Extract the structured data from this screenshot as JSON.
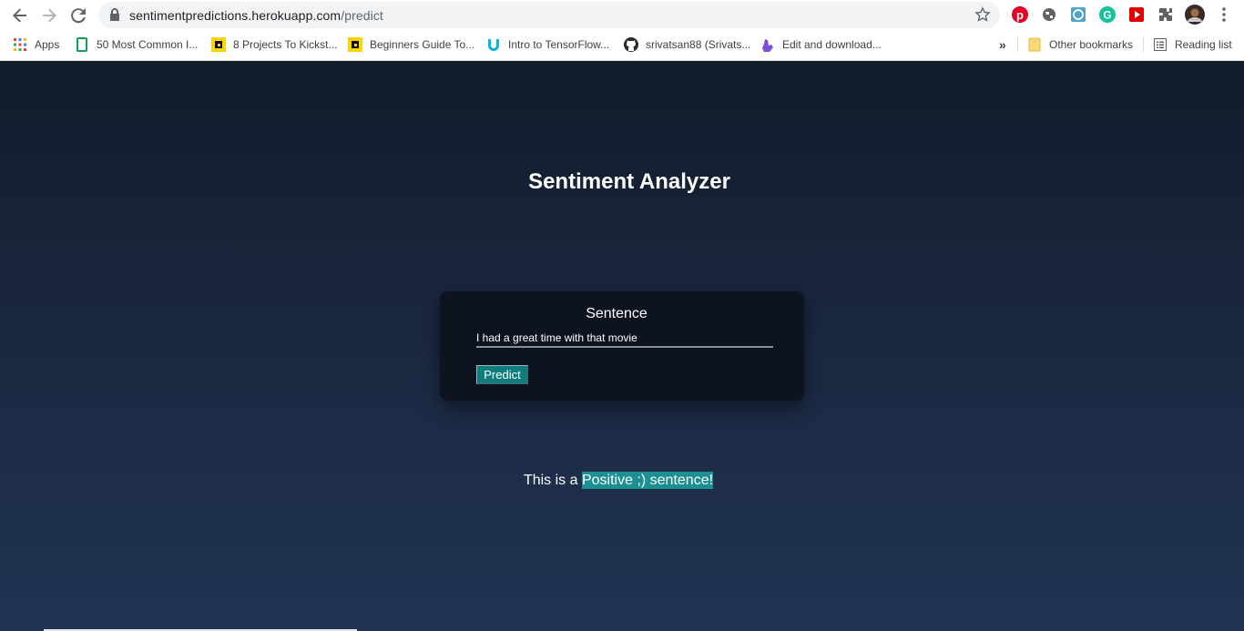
{
  "browser": {
    "url_host": "sentimentpredictions.herokuapp.com",
    "url_path": "/predict",
    "bookmarks": [
      {
        "label": "Apps",
        "icon": "apps-grid-icon"
      },
      {
        "label": "50 Most Common I...",
        "icon": "sheet-icon"
      },
      {
        "label": "8 Projects To Kickst...",
        "icon": "yellow-square-icon"
      },
      {
        "label": "Beginners Guide To...",
        "icon": "yellow-square-icon"
      },
      {
        "label": "Intro to TensorFlow...",
        "icon": "udacity-icon"
      },
      {
        "label": "srivatsan88 (Srivats...",
        "icon": "github-icon"
      },
      {
        "label": "Edit and download...",
        "icon": "purple-hand-icon"
      }
    ],
    "other_bookmarks": "Other bookmarks",
    "reading_list": "Reading list",
    "colors": {
      "pinterest": "#e60023",
      "grammarly": "#15c39a",
      "youtube": "#ff0000"
    }
  },
  "app": {
    "title": "Sentiment Analyzer",
    "form": {
      "label": "Sentence",
      "input_value": "I had a great time with that movie",
      "button_label": "Predict"
    },
    "result": {
      "prefix": "This is a ",
      "highlight": "Positive ;) sentence!"
    },
    "colors": {
      "accent": "#0f7d7e",
      "highlight": "#1b8f92",
      "card": "#0d141f"
    }
  }
}
